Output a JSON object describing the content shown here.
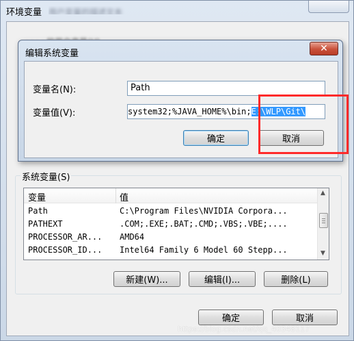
{
  "outer_window": {
    "title": "环境变量",
    "ok_label": "确定",
    "cancel_label": "取消"
  },
  "edit_dialog": {
    "title": "编辑系统变量",
    "close_glyph": "✕",
    "name_label": "变量名(N):",
    "value_label": "变量值(V):",
    "name_value": "Path",
    "value_visible": "system32;%JAVA_HOME%\\bin;",
    "value_selected": "E:\\WLP\\Git\\",
    "ok_label": "确定",
    "cancel_label": "取消"
  },
  "system_vars": {
    "group_label": "系统变量(S)",
    "columns": [
      "变量",
      "值"
    ],
    "rows": [
      {
        "name": "Path",
        "value": "C:\\Program Files\\NVIDIA Corpora..."
      },
      {
        "name": "PATHEXT",
        "value": ".COM;.EXE;.BAT;.CMD;.VBS;.VBE;...."
      },
      {
        "name": "PROCESSOR_AR...",
        "value": "AMD64"
      },
      {
        "name": "PROCESSOR_ID...",
        "value": "Intel64 Family 6 Model 60 Stepp..."
      }
    ],
    "new_label": "新建(W)...",
    "edit_label": "编辑(I)...",
    "delete_label": "删除(L)"
  },
  "watermark": "https://blog.csdn.net/qq_40348117",
  "colors": {
    "highlight": "#3399ff",
    "annotation_red": "#ff2a2a",
    "close_red": "#c9513b"
  }
}
